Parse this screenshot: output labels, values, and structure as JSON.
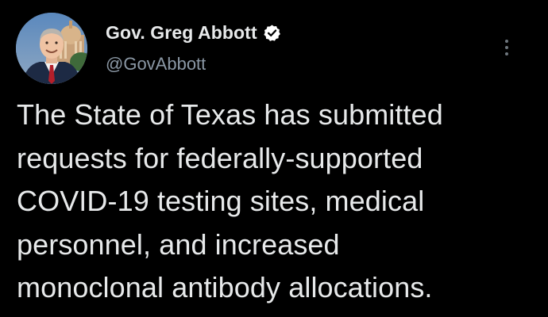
{
  "author": {
    "display_name": "Gov. Greg Abbott",
    "handle": "@GovAbbott",
    "verified": true,
    "avatar_icon": "profile-photo",
    "verified_icon": "verified-badge-icon"
  },
  "tweet": {
    "text_lines": [
      "The State of Texas has submitted",
      "requests for federally-supported",
      "COVID-19 testing sites, medical",
      "personnel, and increased",
      "monoclonal antibody allocations."
    ]
  },
  "menu": {
    "icon": "more-options-icon"
  },
  "colors": {
    "background": "#000000",
    "text_primary": "#e7e9ea",
    "text_secondary": "#8b98a5",
    "verified_badge": "#ffffff"
  }
}
